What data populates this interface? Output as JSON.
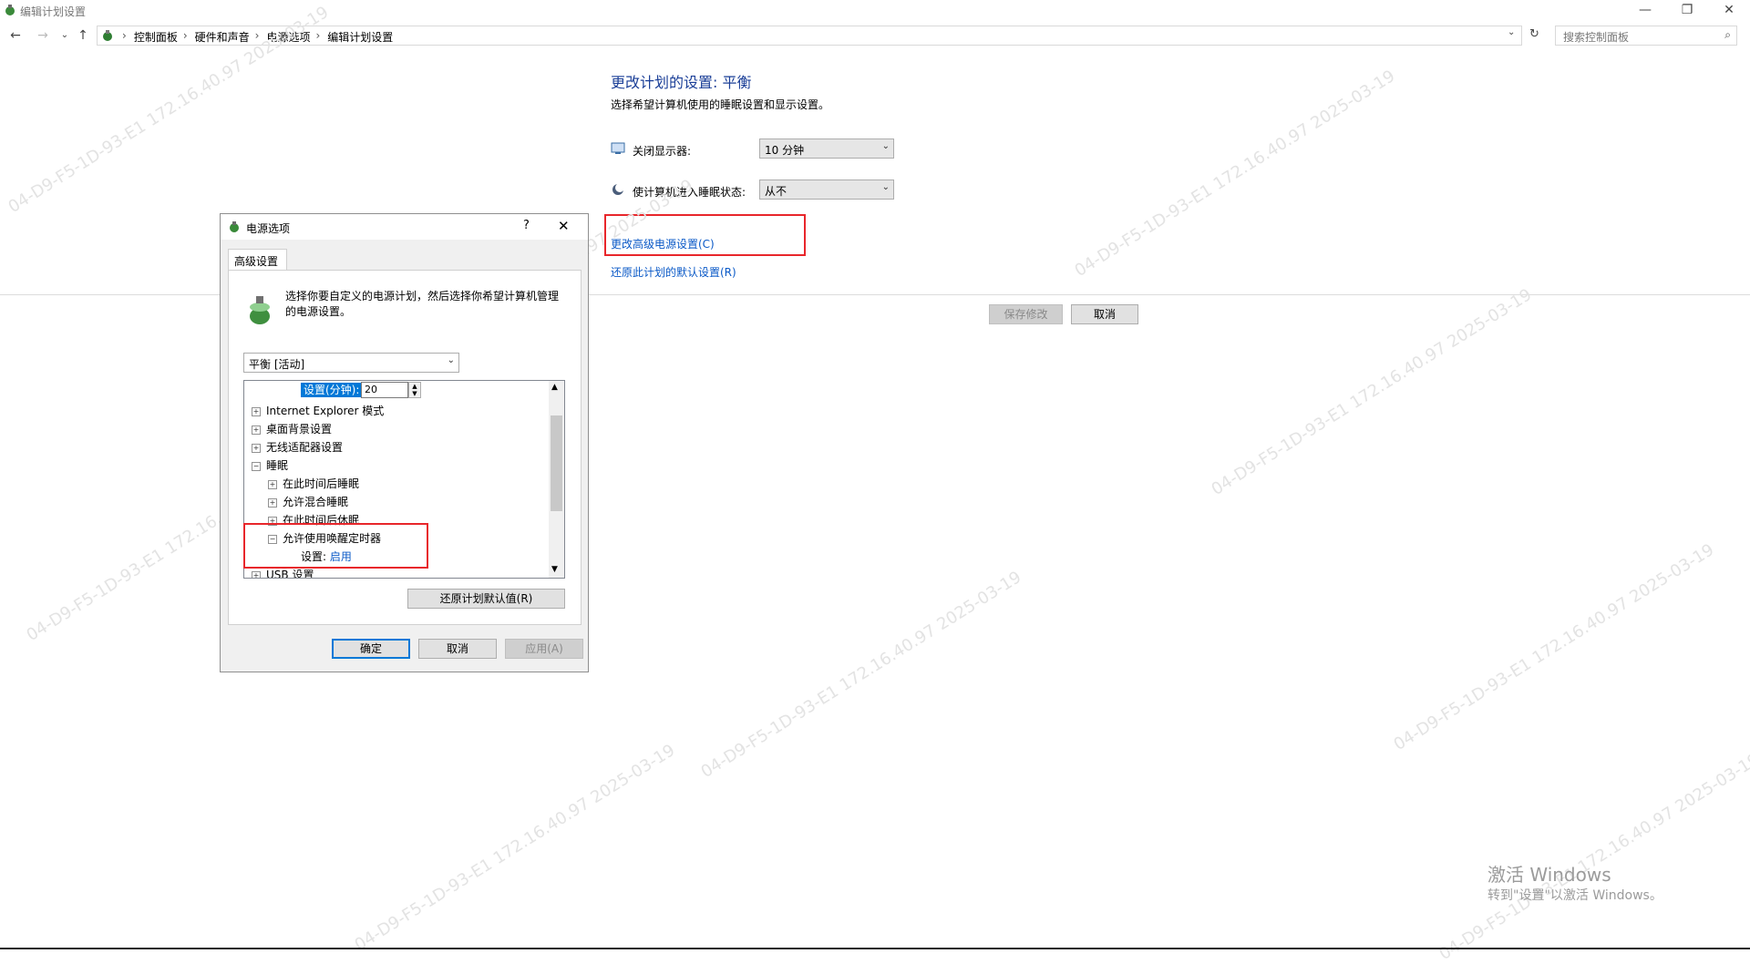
{
  "window": {
    "title": "编辑计划设置"
  },
  "breadcrumbs": [
    "控制面板",
    "硬件和声音",
    "电源选项",
    "编辑计划设置"
  ],
  "search": {
    "placeholder": "搜索控制面板"
  },
  "main": {
    "heading": "更改计划的设置: 平衡",
    "subheading": "选择希望计算机使用的睡眠设置和显示设置。",
    "display_off": {
      "label": "关闭显示器:",
      "value": "10 分钟"
    },
    "sleep": {
      "label": "使计算机进入睡眠状态:",
      "value": "从不"
    },
    "link_advanced": "更改高级电源设置(C)",
    "link_restore": "还原此计划的默认设置(R)",
    "save_label": "保存修改",
    "cancel_label": "取消"
  },
  "dialog": {
    "title": "电源选项",
    "help": "?",
    "tab": "高级设置",
    "description": "选择你要自定义的电源计划，然后选择你希望计算机管理的电源设置。",
    "plan_select": "平衡 [活动]",
    "setting_label": "设置(分钟):",
    "setting_value": "20",
    "tree": [
      {
        "label": "Internet Explorer 模式",
        "level": 0,
        "sign": "+"
      },
      {
        "label": "桌面背景设置",
        "level": 0,
        "sign": "+"
      },
      {
        "label": "无线适配器设置",
        "level": 0,
        "sign": "+"
      },
      {
        "label": "睡眠",
        "level": 0,
        "sign": "−"
      },
      {
        "label": "在此时间后睡眠",
        "level": 1,
        "sign": "+"
      },
      {
        "label": "允许混合睡眠",
        "level": 1,
        "sign": "+"
      },
      {
        "label": "在此时间后休眠",
        "level": 1,
        "sign": "+"
      },
      {
        "label": "允许使用唤醒定时器",
        "level": 1,
        "sign": "−"
      },
      {
        "label": "USB 设置",
        "level": 0,
        "sign": "+"
      }
    ],
    "wake_setting_label": "设置:",
    "wake_setting_value": "启用",
    "restore_button": "还原计划默认值(R)",
    "ok": "确定",
    "cancel": "取消",
    "apply": "应用(A)"
  },
  "activation": {
    "line1": "激活 Windows",
    "line2": "转到\"设置\"以激活 Windows。"
  },
  "watermark": "04-D9-F5-1D-93-E1 172.16.40.97 2025-03-19",
  "colors": {
    "link": "#0a59c7",
    "heading": "#1a3e97",
    "highlight_box": "#e8262b",
    "selection": "#0078d7"
  }
}
